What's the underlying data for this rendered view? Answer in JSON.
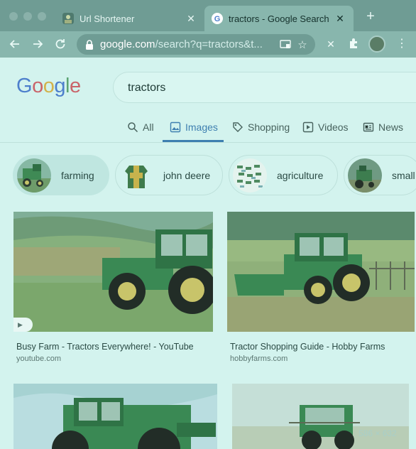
{
  "browser": {
    "tabs": [
      {
        "title": "Url Shortener",
        "close": "✕"
      },
      {
        "title": "tractors - Google Search",
        "close": "✕"
      }
    ],
    "new_tab": "+",
    "url_host": "google.com",
    "url_path": "/search?q=tractors&t...",
    "icons": [
      "back-icon",
      "forward-icon",
      "reload-icon",
      "lock-icon",
      "cast-icon",
      "star-icon",
      "extension-x-icon",
      "puzzle-icon",
      "avatar",
      "menu-icon"
    ]
  },
  "google": {
    "logo_letters": [
      "G",
      "o",
      "o",
      "g",
      "l",
      "e"
    ],
    "query": "tractors",
    "tabs": [
      {
        "label": "All"
      },
      {
        "label": "Images"
      },
      {
        "label": "Shopping"
      },
      {
        "label": "Videos"
      },
      {
        "label": "News"
      }
    ],
    "chips": [
      {
        "label": "farming"
      },
      {
        "label": "john deere"
      },
      {
        "label": "agriculture"
      },
      {
        "label": "small"
      }
    ],
    "results": [
      {
        "title": "Busy Farm - Tractors Everywhere! - YouTube",
        "source": "youtube.com"
      },
      {
        "title": "Tractor Shopping Guide - Hobby Farms",
        "source": "hobbyfarms.com"
      }
    ],
    "size_badge": "586 × 632"
  },
  "colors": {
    "tint": "#d3f3ee",
    "active_tab": "#3e7fb0"
  }
}
